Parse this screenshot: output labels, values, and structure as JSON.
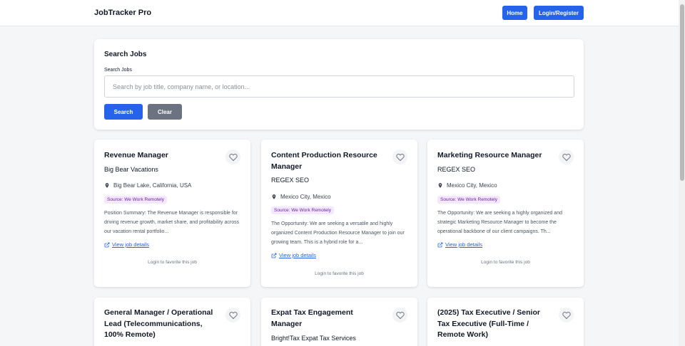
{
  "nav": {
    "brand": "JobTracker Pro",
    "home_label": "Home",
    "login_label": "Login/Register"
  },
  "search": {
    "title": "Search Jobs",
    "label": "Search Jobs",
    "placeholder": "Search by job title, company name, or location...",
    "search_button": "Search",
    "clear_button": "Clear"
  },
  "colors": {
    "primary": "#2563eb",
    "secondary": "#6b7280",
    "badge_bg": "#f3e8ff",
    "badge_text": "#6b21a8"
  },
  "icons": {
    "favorite": "heart-icon",
    "location": "map-pin-icon",
    "link": "external-link-icon"
  },
  "jobs": [
    {
      "title": "Revenue Manager",
      "company": "Big Bear Vacations",
      "location": "Big Bear Lake, California, USA",
      "source": "Source: We Work Remotely",
      "description": "Position Summary: The Revenue Manager is responsible for driving revenue growth, market share, and profitability across our vacation rental portfolio...",
      "link_label": "View job details",
      "login_note": "Login to favorite this job"
    },
    {
      "title": "Content Production Resource Manager",
      "company": "REGEX SEO",
      "location": "Mexico City, Mexico",
      "source": "Source: We Work Remotely",
      "description": "The Opportunity: We are seeking a versatile and highly organized Content Production Resource Manager to join our growing team. This is a hybrid role for a...",
      "link_label": "View job details",
      "login_note": "Login to favorite this job"
    },
    {
      "title": "Marketing Resource Manager",
      "company": "REGEX SEO",
      "location": "Mexico City, Mexico",
      "source": "Source: We Work Remotely",
      "description": "The Opportunity: We are seeking a highly organized and strategic Marketing Resource Manager to become the operational backbone of our client campaigns. Th...",
      "link_label": "View job details",
      "login_note": "Login to favorite this job"
    },
    {
      "title": "General Manager / Operational Lead (Telecommunications, 100% Remote)"
    },
    {
      "title": "Expat Tax Engagement Manager",
      "company": "Bright!Tax Expat Tax Services"
    },
    {
      "title": "(2025) Tax Executive / Senior Tax Executive (Full-Time / Remote Work)"
    }
  ]
}
